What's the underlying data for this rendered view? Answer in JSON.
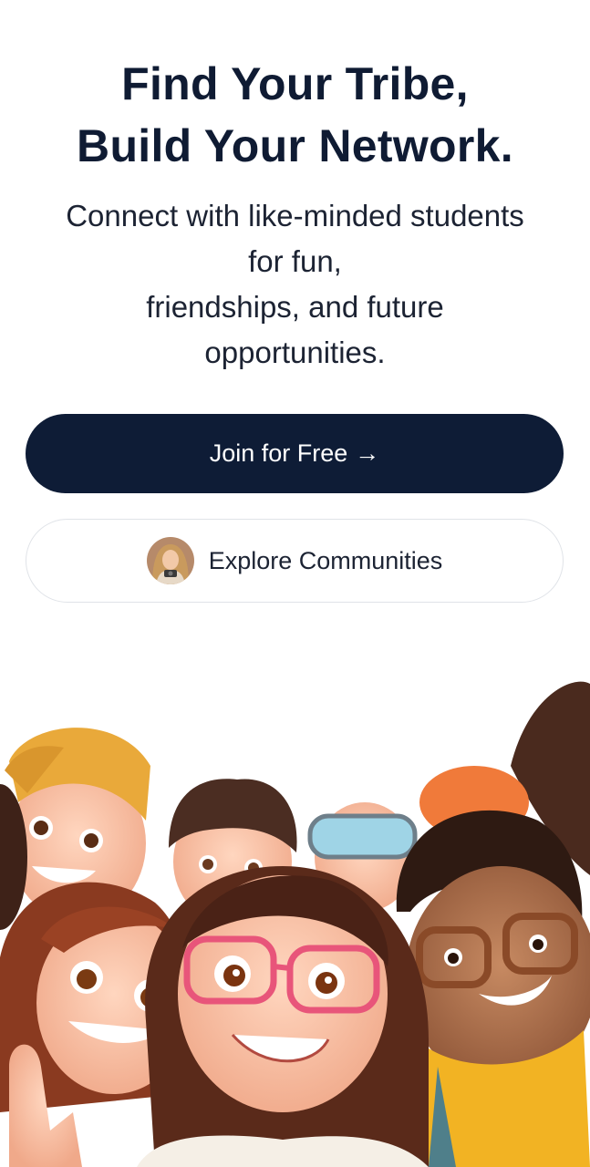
{
  "hero": {
    "headline_line1": "Find Your Tribe,",
    "headline_line2": "Build Your Network.",
    "subtitle_line1": "Connect with like-minded students",
    "subtitle_line2": "for fun,",
    "subtitle_line3": "friendships, and future",
    "subtitle_line4": "opportunities."
  },
  "actions": {
    "join_label": "Join for Free",
    "join_arrow": "→",
    "explore_label": "Explore Communities"
  },
  "colors": {
    "primary": "#0e1c36",
    "text": "#0f1b33",
    "border": "#e0e3e8"
  },
  "icons": {
    "arrow": "arrow-right-icon",
    "avatar": "user-avatar"
  }
}
